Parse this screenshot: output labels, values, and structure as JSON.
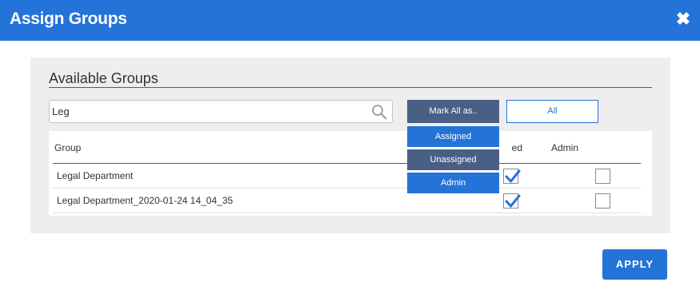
{
  "dialog": {
    "title": "Assign Groups",
    "close_icon": "close-icon"
  },
  "panel": {
    "heading": "Available Groups"
  },
  "search": {
    "value": "Leg",
    "placeholder": "",
    "icon": "search-icon"
  },
  "toolbar": {
    "mark_all_label": "Mark All as..",
    "filter_label": "All"
  },
  "mark_all_menu": {
    "items": [
      {
        "label": "Assigned",
        "style": "blue"
      },
      {
        "label": "Unassigned",
        "style": "slate"
      },
      {
        "label": "Admin",
        "style": "blue"
      }
    ]
  },
  "table": {
    "columns": {
      "group": "Group",
      "assigned": "ed",
      "admin": "Admin"
    },
    "rows": [
      {
        "name": "Legal Department",
        "assigned": true,
        "admin": false
      },
      {
        "name": "Legal Department_2020-01-24 14_04_35",
        "assigned": true,
        "admin": false
      }
    ]
  },
  "footer": {
    "apply_label": "APPLY"
  },
  "colors": {
    "primary": "#2473d8",
    "slate": "#4a5f85",
    "panel_bg": "#eeeeee"
  }
}
